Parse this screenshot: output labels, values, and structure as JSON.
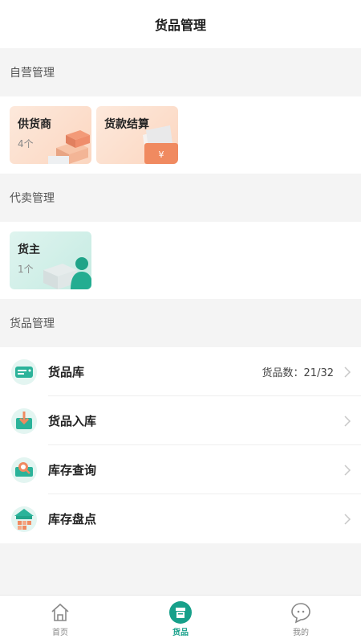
{
  "header": {
    "title": "货品管理"
  },
  "self_section": {
    "title": "自营管理",
    "cards": [
      {
        "title": "供货商",
        "sub": "4个"
      },
      {
        "title": "货款结算",
        "sub": ""
      }
    ]
  },
  "consign_section": {
    "title": "代卖管理",
    "cards": [
      {
        "title": "货主",
        "sub": "1个"
      }
    ]
  },
  "goods_section": {
    "title": "货品管理",
    "rows": [
      {
        "label": "货品库",
        "meta": "货品数：21/32"
      },
      {
        "label": "货品入库"
      },
      {
        "label": "库存查询"
      },
      {
        "label": "库存盘点"
      }
    ]
  },
  "tabbar": {
    "tabs": [
      {
        "label": "首页",
        "icon": "home-icon"
      },
      {
        "label": "货品",
        "icon": "goods-icon",
        "active": true
      },
      {
        "label": "我的",
        "icon": "chat-icon"
      }
    ]
  },
  "colors": {
    "accent": "#17a08a",
    "orange": "#f28a5c",
    "teal": "#2bb39a"
  }
}
